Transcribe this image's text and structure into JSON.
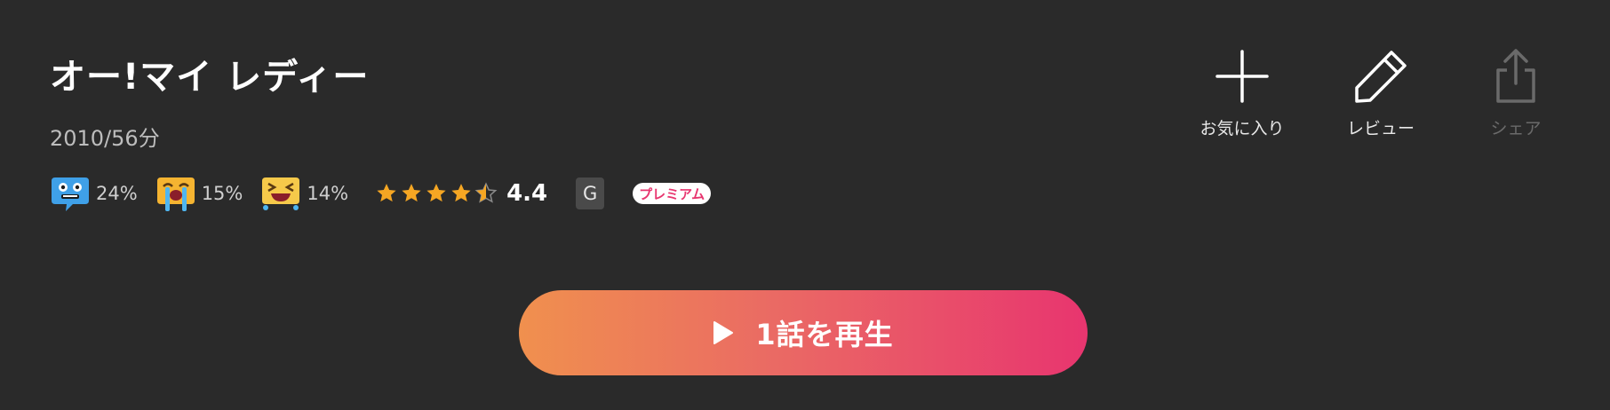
{
  "title": "オー!マイ レディー",
  "meta": "2010/56分",
  "reactions": [
    {
      "icon": "shocked-face-icon",
      "percent": "24%"
    },
    {
      "icon": "crying-face-icon",
      "percent": "15%"
    },
    {
      "icon": "laughing-face-icon",
      "percent": "14%"
    }
  ],
  "rating": {
    "value": "4.4",
    "stars": 4.4,
    "max": 5,
    "star_color": "#f5a623"
  },
  "age_rating": "G",
  "premium_label": "プレミアム",
  "actions": {
    "favorite": {
      "label": "お気に入り",
      "icon": "plus-icon"
    },
    "review": {
      "label": "レビュー",
      "icon": "pencil-icon"
    },
    "share": {
      "label": "シェア",
      "icon": "share-icon",
      "disabled": true
    }
  },
  "play_button": {
    "label": "1話を再生",
    "icon": "play-icon",
    "gradient": [
      "#f0904e",
      "#e8356f"
    ]
  },
  "colors": {
    "background": "#2a2a2a",
    "accent": "#e8356f"
  }
}
